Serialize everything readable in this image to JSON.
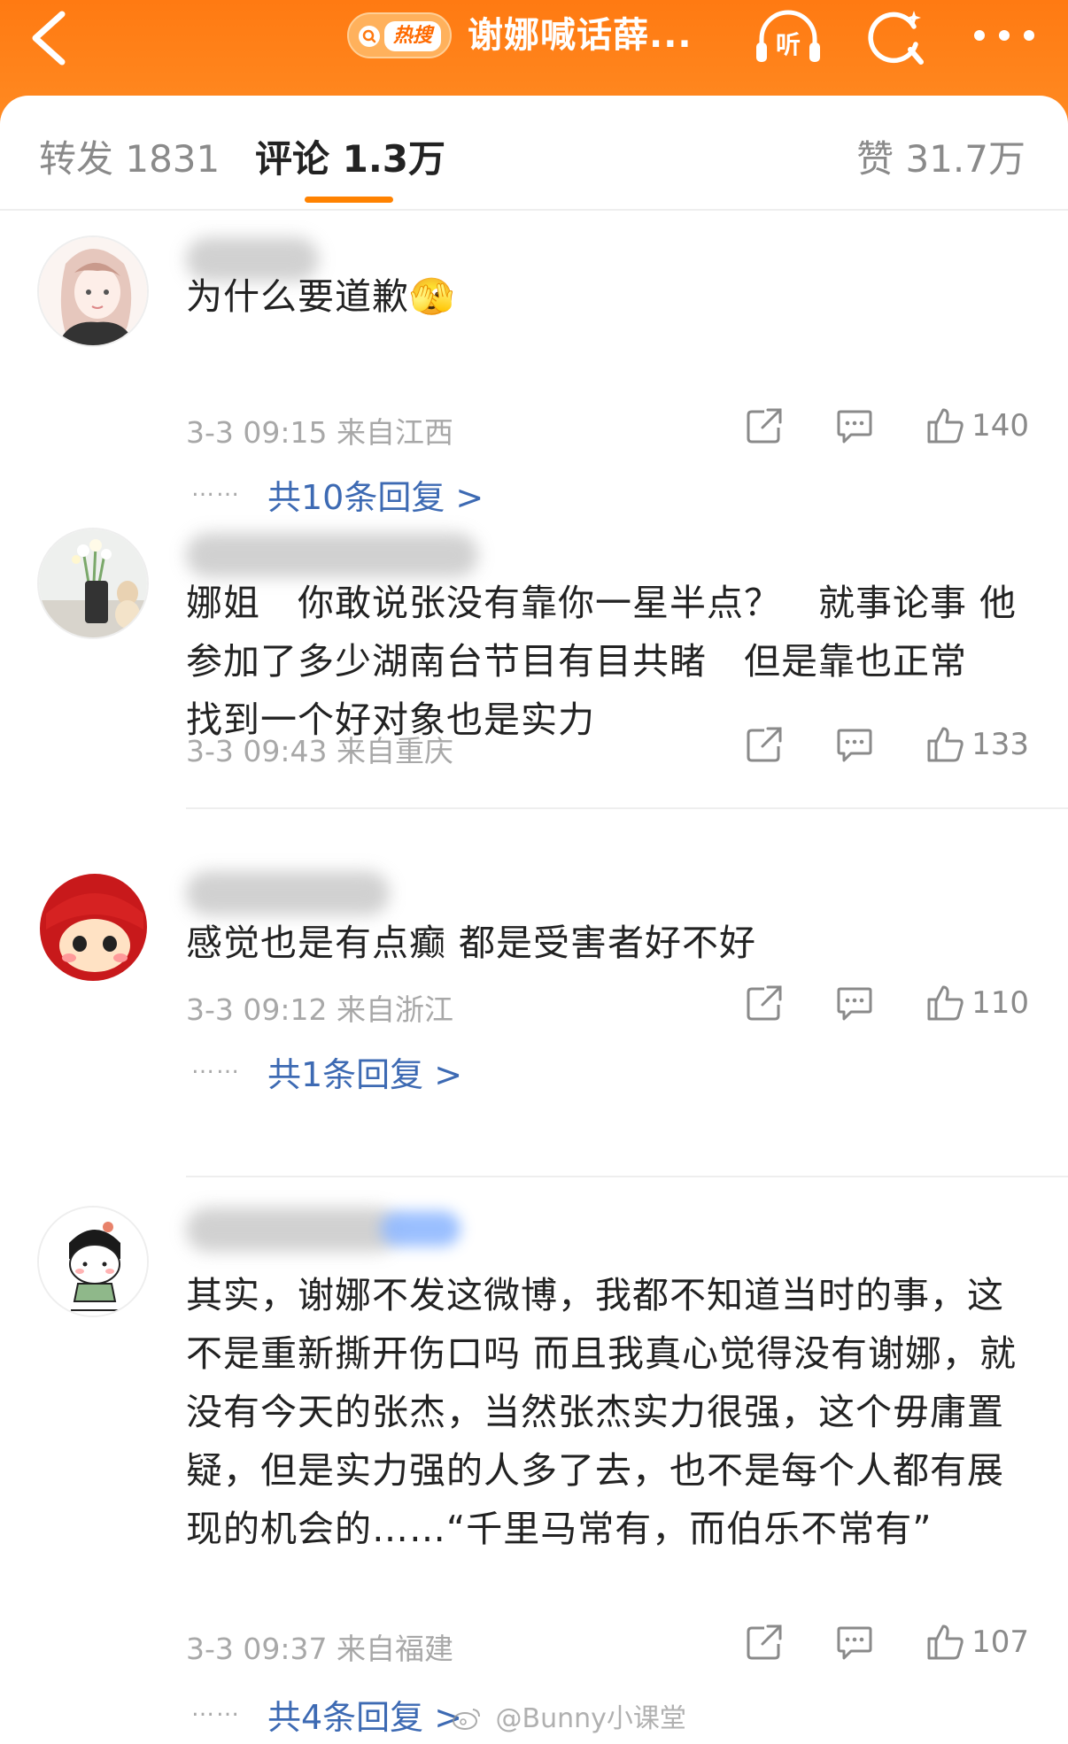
{
  "header": {
    "hot_tag": "热搜",
    "title": "谢娜喊话薛...",
    "listen_label": "听"
  },
  "tabs": {
    "repost": "转发 1831",
    "comment": "评论 1.3万",
    "like": "赞 31.7万"
  },
  "comments": [
    {
      "text": "为什么要道歉🫣",
      "meta": "3-3 09:15  来自江西",
      "likes": "140",
      "replies": "共10条回复 >"
    },
    {
      "text": "娜姐　你敢说张没有靠你一星半点？　就事论事 他参加了多少湖南台节目有目共睹　但是靠也正常　找到一个好对象也是实力",
      "meta": "3-3 09:43  来自重庆",
      "likes": "133",
      "replies": ""
    },
    {
      "text": "感觉也是有点癫 都是受害者好不好",
      "meta": "3-3 09:12  来自浙江",
      "likes": "110",
      "replies": "共1条回复 >"
    },
    {
      "text": "其实，谢娜不发这微博，我都不知道当时的事，这不是重新撕开伤口吗 而且我真心觉得没有谢娜，就没有今天的张杰，当然张杰实力很强，这个毋庸置疑，但是实力强的人多了去，也不是每个人都有展现的机会的……“千里马常有，而伯乐不常有”",
      "meta": "3-3 09:37  来自福建",
      "likes": "107",
      "replies": "共4条回复 >"
    }
  ],
  "reply_dots": "……",
  "watermark": "@Bunny小课堂",
  "colors": {
    "brand_orange": "#ff7a12",
    "link_blue": "#3d6ab3",
    "meta_gray": "#a8a8a8"
  }
}
